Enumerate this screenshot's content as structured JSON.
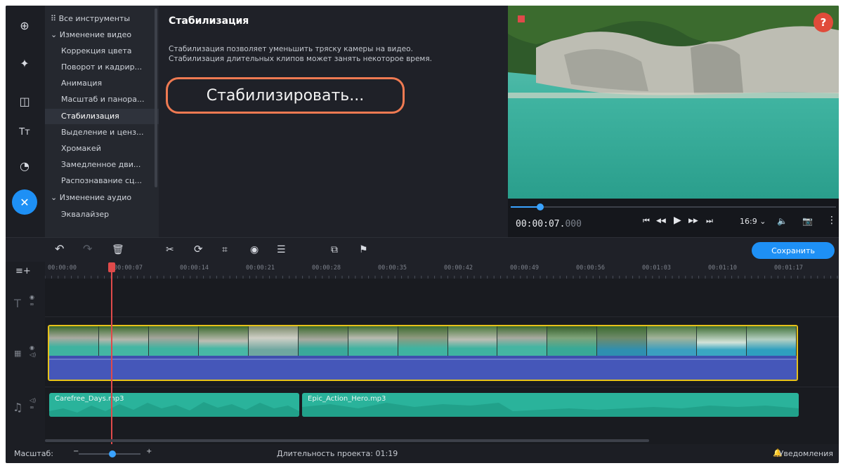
{
  "sidebar": {
    "tools": [
      {
        "icon": "import-icon",
        "glyph": "⊕"
      },
      {
        "icon": "magic-wand-icon",
        "glyph": "✦"
      },
      {
        "icon": "transitions-icon",
        "glyph": "◫"
      },
      {
        "icon": "titles-icon",
        "glyph": "Tт"
      },
      {
        "icon": "stickers-icon",
        "glyph": "◔"
      },
      {
        "icon": "tools-icon",
        "glyph": "✕",
        "active": true
      }
    ]
  },
  "fx_list": {
    "items": [
      {
        "label": "Все инструменты",
        "type": "group",
        "marker": "⠿"
      },
      {
        "label": "Изменение видео",
        "type": "group",
        "marker": "⌄"
      },
      {
        "label": "Коррекция цвета"
      },
      {
        "label": "Поворот и кадрир..."
      },
      {
        "label": "Анимация"
      },
      {
        "label": "Масштаб и панора..."
      },
      {
        "label": "Стабилизация",
        "selected": true
      },
      {
        "label": "Выделение и ценз..."
      },
      {
        "label": "Хромакей"
      },
      {
        "label": "Замедленное дви..."
      },
      {
        "label": "Распознавание сц..."
      },
      {
        "label": "Изменение аудио",
        "type": "group",
        "marker": "⌄"
      },
      {
        "label": "Эквалайзер"
      }
    ]
  },
  "props": {
    "title": "Стабилизация",
    "desc_line1": "Стабилизация позволяет уменьшить тряску камеры на видео.",
    "desc_line2": "Стабилизация длительных клипов может занять некоторое время.",
    "stabilize_button": "Стабилизировать..."
  },
  "preview": {
    "help": "?",
    "seek_progress": 0.09,
    "timecode_main": "00:00:07.",
    "timecode_ms": "000",
    "aspect": "16:9 ⌄",
    "controls": {
      "prev": "⏮",
      "step_back": "◀◀",
      "play": "▶",
      "step_fwd": "▶▶",
      "next": "⏭",
      "volume": "🔈",
      "snapshot": "📷",
      "more": "⋮"
    }
  },
  "timeline_toolbar": {
    "undo": "↶",
    "redo": "↷",
    "delete": "🗑",
    "cut": "✂",
    "rotate": "⟳",
    "crop": "⌗",
    "color": "◉",
    "adjust": "☰",
    "overlay": "⧉",
    "marker": "⚑",
    "save_label": "Сохранить"
  },
  "ruler": {
    "ticks": [
      "00:00:00",
      "00:00:07",
      "00:00:14",
      "00:00:21",
      "00:00:28",
      "00:00:35",
      "00:00:42",
      "00:00:49",
      "00:00:56",
      "00:01:03",
      "00:01:10",
      "00:01:17"
    ]
  },
  "tracks": {
    "audio_clips": [
      {
        "label": "Carefree_Days.mp3"
      },
      {
        "label": "Epic_Action_Hero.mp3"
      }
    ]
  },
  "statusbar": {
    "zoom_label": "Масштаб:",
    "zoom_minus": "−",
    "zoom_plus": "+",
    "zoom_level": 0.55,
    "duration": "Длительность проекта: 01:19",
    "notifications": "Уведомления"
  },
  "colors": {
    "accent": "#1e90f5",
    "highlight": "#ef7a52",
    "clip_border": "#e7c21a",
    "audio": "#2ab39b"
  }
}
